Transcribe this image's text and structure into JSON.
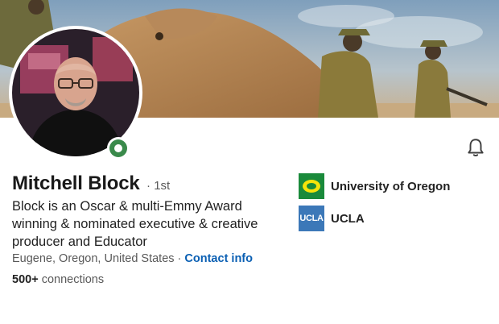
{
  "profile": {
    "name": "Mitchell Block",
    "degree": "· 1st",
    "headline": "Block is an Oscar & multi-Emmy Award winning & nominated executive & creative producer and Educator",
    "location": "Eugene, Oregon, United States",
    "separator": " · ",
    "contact_label": "Contact info",
    "connections_count": "500+",
    "connections_label": " connections"
  },
  "education": [
    {
      "name": "University of Oregon",
      "logo_icon": "oregon-o-logo",
      "logo_color": "#1a8a3b"
    },
    {
      "name": "UCLA",
      "logo_text": "UCLA",
      "logo_color": "#3c78b8"
    }
  ],
  "colors": {
    "link": "#0a5fb3",
    "status_green": "#3a8a4b"
  },
  "icons": {
    "notification": "bell-icon",
    "status": "open-to-work-status-icon"
  }
}
